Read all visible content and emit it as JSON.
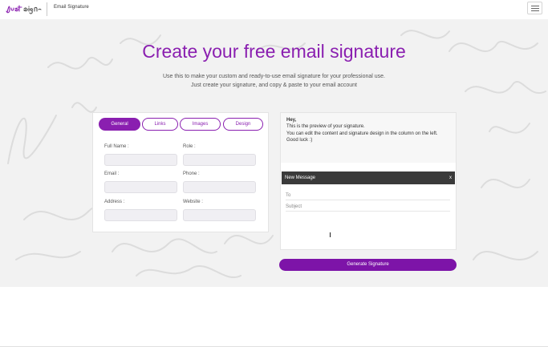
{
  "header": {
    "logo_text": "JustSign",
    "product_name": "Email Signature",
    "menu_icon": "hamburger-icon"
  },
  "hero": {
    "title": "Create your free email signature",
    "subtitle_line1": "Use this to make your custom and ready-to-use email signature for your professional use.",
    "subtitle_line2": "Just create your signature, and copy & paste to your email account"
  },
  "form": {
    "tabs": [
      {
        "label": "General",
        "active": true
      },
      {
        "label": "Links",
        "active": false
      },
      {
        "label": "Images",
        "active": false
      },
      {
        "label": "Design",
        "active": false
      }
    ],
    "fields": [
      {
        "label": "Full Name :",
        "value": ""
      },
      {
        "label": "Role :",
        "value": ""
      },
      {
        "label": "Email :",
        "value": ""
      },
      {
        "label": "Phone :",
        "value": ""
      },
      {
        "label": "Address :",
        "value": ""
      },
      {
        "label": "Website :",
        "value": ""
      }
    ]
  },
  "preview": {
    "greeting": "Hey,",
    "line1": "This is the preview of your signature.",
    "line2": "You can edit the content and signature design in the column on the left.",
    "line3": "Good luck :)",
    "mail_title": "New Message",
    "mail_close": "x",
    "to_label": "To",
    "subject_label": "Subject"
  },
  "actions": {
    "generate_label": "Generate Signature"
  },
  "colors": {
    "accent": "#8a1fb0",
    "button": "#7d14a8",
    "mail_header": "#3a3a3a",
    "hero_bg": "#f2f2f2"
  }
}
